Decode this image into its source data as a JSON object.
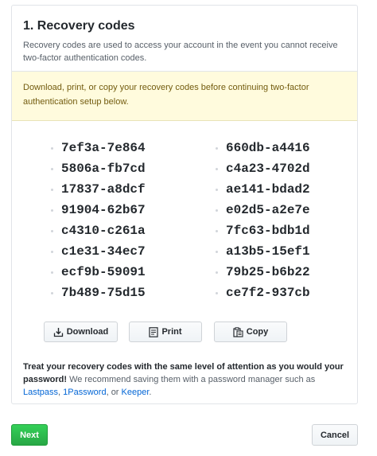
{
  "section": {
    "title": "1. Recovery codes",
    "description": "Recovery codes are used to access your account in the event you cannot receive two-factor authentication codes."
  },
  "notice": {
    "text": "Download, print, or copy your recovery codes before continuing two-factor authentication setup below."
  },
  "codes": {
    "left": [
      "7ef3a-7e864",
      "5806a-fb7cd",
      "17837-a8dcf",
      "91904-62b67",
      "c4310-c261a",
      "c1e31-34ec7",
      "ecf9b-59091",
      "7b489-75d15"
    ],
    "right": [
      "660db-a4416",
      "c4a23-4702d",
      "ae141-bdad2",
      "e02d5-a2e7e",
      "7fc63-bdb1d",
      "a13b5-15ef1",
      "79b25-b6b22",
      "ce7f2-937cb"
    ]
  },
  "actions": {
    "download_label": "Download",
    "download_icon": "download-icon",
    "print_label": "Print",
    "print_icon": "print-icon",
    "copy_label": "Copy",
    "copy_icon": "clipboard-icon"
  },
  "warning": {
    "strong": "Treat your recovery codes with the same level of attention as you would your password!",
    "text": "We recommend saving them with a password manager such as",
    "link_lastpass": "Lastpass",
    "sep1": ",",
    "link_1password": "1Password",
    "sep2": ", or",
    "link_keeper": "Keeper",
    "end": "."
  },
  "footer": {
    "next_label": "Next",
    "cancel_label": "Cancel"
  },
  "colors": {
    "primary_green": "#28a745",
    "link_blue": "#0366d6",
    "notice_background": "#fffbdd",
    "notice_text": "#735c0f"
  }
}
